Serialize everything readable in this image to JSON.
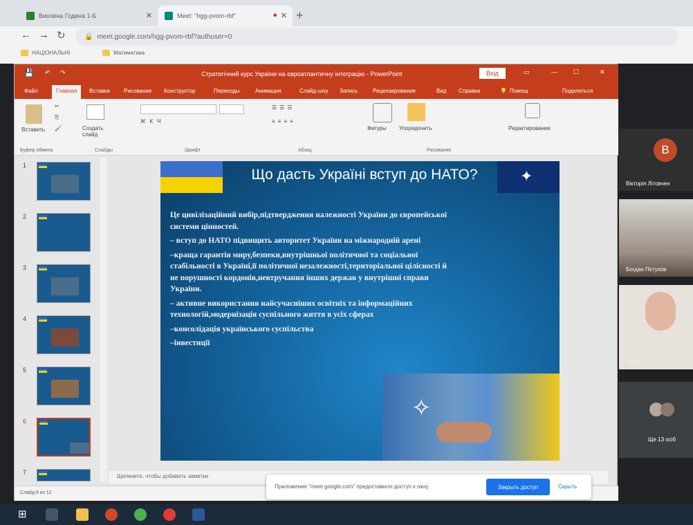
{
  "browser": {
    "tabs": [
      {
        "title": "Виховна Година 1-Б",
        "active": false
      },
      {
        "title": "Meet: \"hgg-pvom-rbf\"",
        "active": true
      }
    ],
    "address": "meet.google.com/hgg-pvom-rbf?authuser=0",
    "bookmarks": [
      "НАЦІОНАЛЬНІ",
      "Математика"
    ]
  },
  "powerpoint": {
    "title": "Стратегічний курс України на євроатлантичну інтеграцію - PowerPoint",
    "signin": "Вхід",
    "tabs": [
      "Файл",
      "Главная",
      "Вставка",
      "Рисование",
      "Конструктор",
      "Переходы",
      "Анимация",
      "Слайд-шоу",
      "Запись",
      "Рецензирование",
      "Вид",
      "Справка",
      "Помощ",
      "Поделиться"
    ],
    "ribbon": {
      "paste": "Вставить",
      "create_slide": "Создать слайд",
      "shapes": "Фигуры",
      "arrange": "Упорядочить",
      "editing": "Редактирование",
      "groups": [
        "Буфер обмена",
        "Слайды",
        "Шрифт",
        "Абзац",
        "Рисование"
      ]
    },
    "thumbnails": [
      "1",
      "2",
      "3",
      "4",
      "5",
      "6",
      "7"
    ],
    "slide": {
      "title": "Що дасть Україні вступ до НАТО?",
      "paragraphs": [
        "Це цивілізаційний вибір,підтвердження належності України до європейської системи цінностей.",
        "– вступ до НАТО підвищить авторитет України на міжнародній арені",
        "–краща гарантія миру,безпеки,внутрішньої політичної та соціальної стабільності в Україні,її політичної незалежності,територіальної цілісності й не порушності кордонів,невтручання інших держав у внутрішні справи України.",
        "– активне використання найсучасніших освітніх та інформаційних технологій,модернізація суспільного життя в усіх сферах",
        "–консолідація українського суспільства",
        "–інвестиції"
      ]
    },
    "notes_placeholder": "Щелкните, чтобы добавить заметки",
    "status": "Слайд 6 из 12"
  },
  "meet": {
    "participants": [
      {
        "initial": "B",
        "name": "Вікторія Літовчен"
      },
      {
        "name": "Богдан Пєтухов"
      },
      {
        "name": "Злата"
      }
    ],
    "more": "Ще 13 осіб"
  },
  "share_banner": {
    "message": "Приложение \"meet.google.com\" предоставило доступ к окну.",
    "close_button": "Закрыть доступ",
    "hide_link": "Скрыть"
  }
}
